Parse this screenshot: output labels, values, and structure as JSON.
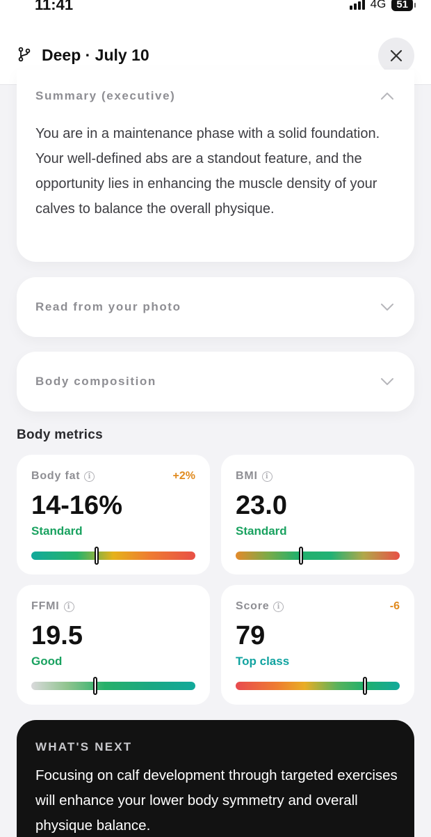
{
  "status_bar": {
    "time": "11:41",
    "network": "4G",
    "battery": "51"
  },
  "header": {
    "title": "Deep · July 10",
    "branch_icon": "branch-icon",
    "close_icon": "close-icon"
  },
  "summary": {
    "label": "Summary (executive)",
    "text": "You are in a maintenance phase with a solid foundation. Your well-defined abs are a standout feature, and the opportunity lies in enhancing the muscle density of your calves to balance the overall physique."
  },
  "sections": {
    "read_from_photo": "Read from your photo",
    "body_composition": "Body composition"
  },
  "metrics": {
    "title": "Body metrics",
    "items": [
      {
        "label": "Body fat",
        "delta": "+2%",
        "value": "14-16%",
        "status": "Standard",
        "status_color": "#1aa260",
        "level": 0.4
      },
      {
        "label": "BMI",
        "delta": "",
        "value": "23.0",
        "status": "Standard",
        "status_color": "#1aa260",
        "level": 0.4
      },
      {
        "label": "FFMI",
        "delta": "",
        "value": "19.5",
        "status": "Good",
        "status_color": "#1aa260",
        "level": 0.39
      },
      {
        "label": "Score",
        "delta": "-6",
        "value": "79",
        "status": "Top class",
        "status_color": "#11a3a0",
        "level": 0.79
      }
    ]
  },
  "whats_next": {
    "label": "WHAT'S NEXT",
    "text": "Focusing on calf development through targeted exercises will enhance your lower body symmetry and overall physique balance."
  },
  "colors": {
    "accent_green": "#1aa260",
    "accent_orange": "#e08a1e",
    "teal": "#11a3a0"
  }
}
